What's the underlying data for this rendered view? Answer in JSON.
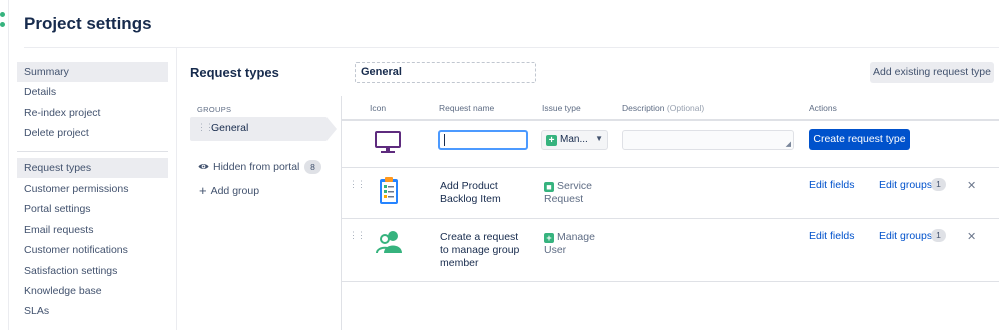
{
  "page": {
    "title": "Project settings"
  },
  "sidebar": {
    "items": [
      {
        "label": "Summary",
        "selected": true
      },
      {
        "label": "Details"
      },
      {
        "label": "Re-index project"
      },
      {
        "label": "Delete project"
      },
      {
        "label": "Request types",
        "selected": true
      },
      {
        "label": "Customer permissions"
      },
      {
        "label": "Portal settings"
      },
      {
        "label": "Email requests"
      },
      {
        "label": "Customer notifications"
      },
      {
        "label": "Satisfaction settings"
      },
      {
        "label": "Knowledge base"
      },
      {
        "label": "SLAs"
      }
    ]
  },
  "main": {
    "section_title": "Request types",
    "group_name_value": "General",
    "add_existing_label": "Add existing request type"
  },
  "groups": {
    "heading": "GROUPS",
    "items": [
      {
        "label": "General",
        "selected": true
      }
    ],
    "hidden_label": "Hidden from portal",
    "hidden_count": "8",
    "add_group_label": "Add group"
  },
  "table": {
    "headers": {
      "icon": "Icon",
      "name": "Request name",
      "issue_type": "Issue type",
      "description": "Description",
      "description_optional": "(Optional)",
      "actions": "Actions"
    },
    "new_row": {
      "name_value": "",
      "issue_type_selected": "Man...",
      "description_value": "",
      "create_label": "Create request type"
    },
    "rows": [
      {
        "name": "Add Product Backlog Item",
        "issue_type": "Service Request",
        "edit_fields": "Edit fields",
        "edit_groups": "Edit groups",
        "groups_count": "1",
        "icon": "clipboard-checklist-icon"
      },
      {
        "name": "Create a request to manage group member",
        "issue_type": "Manage User",
        "edit_fields": "Edit fields",
        "edit_groups": "Edit groups",
        "groups_count": "1",
        "icon": "users-icon"
      }
    ]
  },
  "colors": {
    "primary": "#0052cc",
    "issue_type_green": "#36b37e",
    "selected_bg": "#ebecf0",
    "monitor_purple": "#5e2b7e"
  }
}
